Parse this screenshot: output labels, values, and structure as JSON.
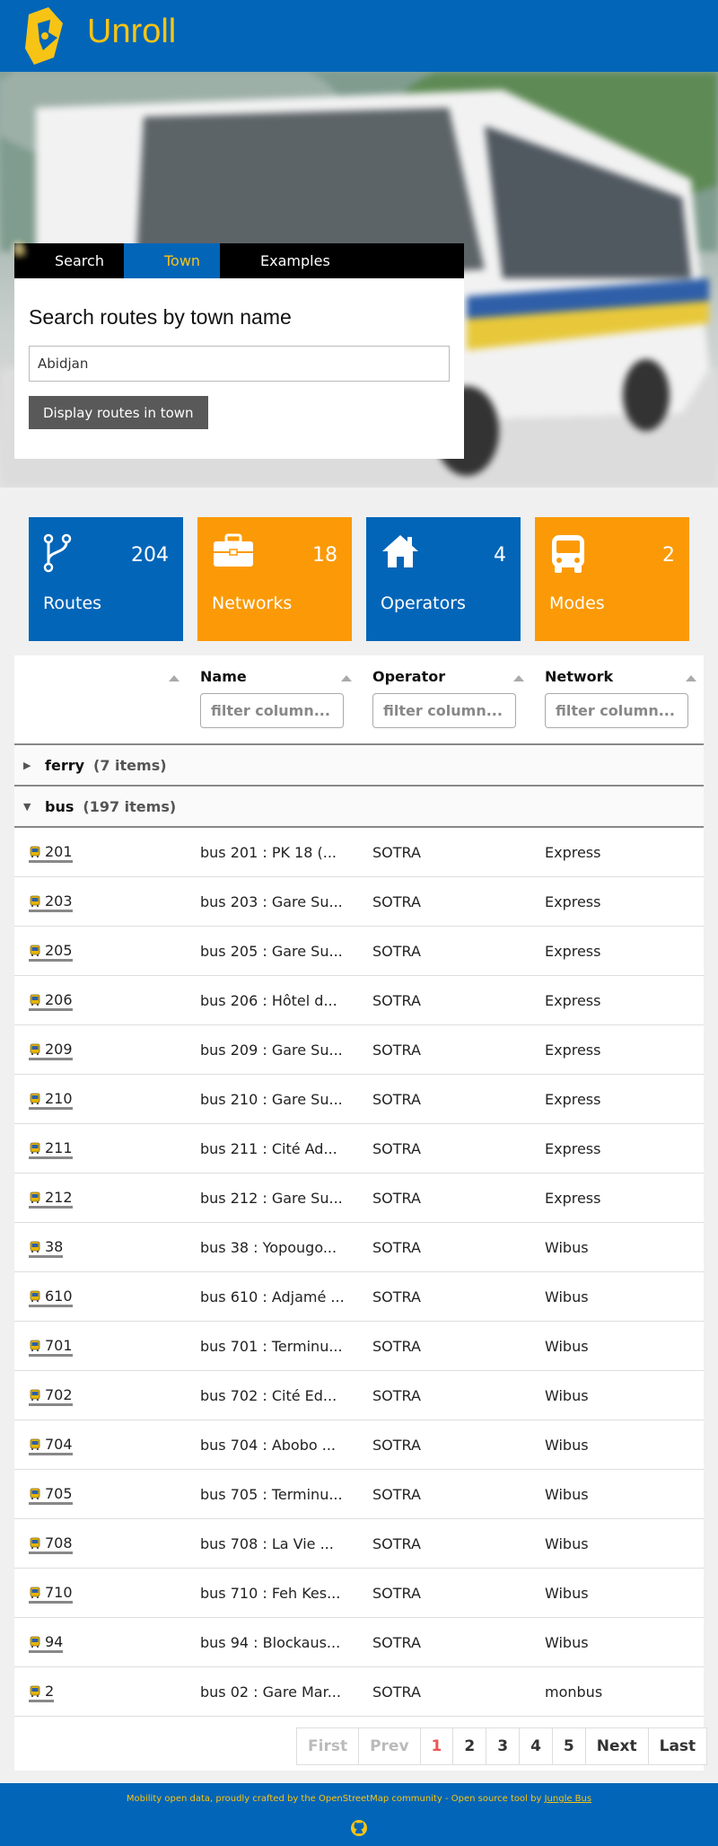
{
  "header": {
    "title": "Unroll"
  },
  "search": {
    "tabs": [
      {
        "label": "Search",
        "icon": "search-icon"
      },
      {
        "label": "Town",
        "icon": "person-icon"
      },
      {
        "label": "Examples",
        "icon": "exclamation-icon"
      }
    ],
    "active_tab": "Town",
    "heading": "Search routes by town name",
    "input_value": "Abidjan",
    "button_label": "Display routes in town"
  },
  "stats": [
    {
      "label": "Routes",
      "count": "204",
      "icon": "route-fork-icon",
      "color": "#0265b8"
    },
    {
      "label": "Networks",
      "count": "18",
      "icon": "briefcase-icon",
      "color": "#fb9a06"
    },
    {
      "label": "Operators",
      "count": "4",
      "icon": "home-icon",
      "color": "#0265b8"
    },
    {
      "label": "Modes",
      "count": "2",
      "icon": "bus-icon",
      "color": "#fb9a06"
    }
  ],
  "table": {
    "columns": [
      "",
      "Name",
      "Operator",
      "Network"
    ],
    "filter_placeholder": "filter column...",
    "groups": [
      {
        "name": "ferry",
        "count": "(7 items)",
        "expanded": false
      },
      {
        "name": "bus",
        "count": "(197 items)",
        "expanded": true
      }
    ],
    "rows": [
      {
        "ref": "201",
        "name": "bus 201 : PK 18 (...",
        "operator": "SOTRA",
        "network": "Express"
      },
      {
        "ref": "203",
        "name": "bus 203 : Gare Su...",
        "operator": "SOTRA",
        "network": "Express"
      },
      {
        "ref": "205",
        "name": "bus 205 : Gare Su...",
        "operator": "SOTRA",
        "network": "Express"
      },
      {
        "ref": "206",
        "name": "bus 206 : Hôtel d...",
        "operator": "SOTRA",
        "network": "Express"
      },
      {
        "ref": "209",
        "name": "bus 209 : Gare Su...",
        "operator": "SOTRA",
        "network": "Express"
      },
      {
        "ref": "210",
        "name": "bus 210 : Gare Su...",
        "operator": "SOTRA",
        "network": "Express"
      },
      {
        "ref": "211",
        "name": "bus 211 : Cité Ad...",
        "operator": "SOTRA",
        "network": "Express"
      },
      {
        "ref": "212",
        "name": "bus 212 : Gare Su...",
        "operator": "SOTRA",
        "network": "Express"
      },
      {
        "ref": "38",
        "name": "bus 38 : Yopougo...",
        "operator": "SOTRA",
        "network": "Wibus"
      },
      {
        "ref": "610",
        "name": "bus 610 : Adjamé ...",
        "operator": "SOTRA",
        "network": "Wibus"
      },
      {
        "ref": "701",
        "name": "bus 701 : Terminu...",
        "operator": "SOTRA",
        "network": "Wibus"
      },
      {
        "ref": "702",
        "name": "bus 702 : Cité Ed...",
        "operator": "SOTRA",
        "network": "Wibus"
      },
      {
        "ref": "704",
        "name": "bus 704 : Abobo ...",
        "operator": "SOTRA",
        "network": "Wibus"
      },
      {
        "ref": "705",
        "name": "bus 705 : Terminu...",
        "operator": "SOTRA",
        "network": "Wibus"
      },
      {
        "ref": "708",
        "name": "bus 708 : La Vie ...",
        "operator": "SOTRA",
        "network": "Wibus"
      },
      {
        "ref": "710",
        "name": "bus 710 : Feh Kes...",
        "operator": "SOTRA",
        "network": "Wibus"
      },
      {
        "ref": "94",
        "name": "bus 94 : Blockaus...",
        "operator": "SOTRA",
        "network": "Wibus"
      },
      {
        "ref": "2",
        "name": "bus 02 : Gare Mar...",
        "operator": "SOTRA",
        "network": "monbus"
      }
    ]
  },
  "pagination": {
    "first": "First",
    "prev": "Prev",
    "pages": [
      "1",
      "2",
      "3",
      "4",
      "5"
    ],
    "current": "1",
    "next": "Next",
    "last": "Last"
  },
  "footer": {
    "text": "Mobility open data, proudly crafted by the OpenStreetMap community - Open source tool by",
    "link": "Jungle Bus",
    "icon": "github-icon"
  },
  "colors": {
    "brand_blue": "#0265b8",
    "brand_yellow": "#f7c416",
    "orange": "#fb9a06",
    "button_gray": "#595959"
  }
}
